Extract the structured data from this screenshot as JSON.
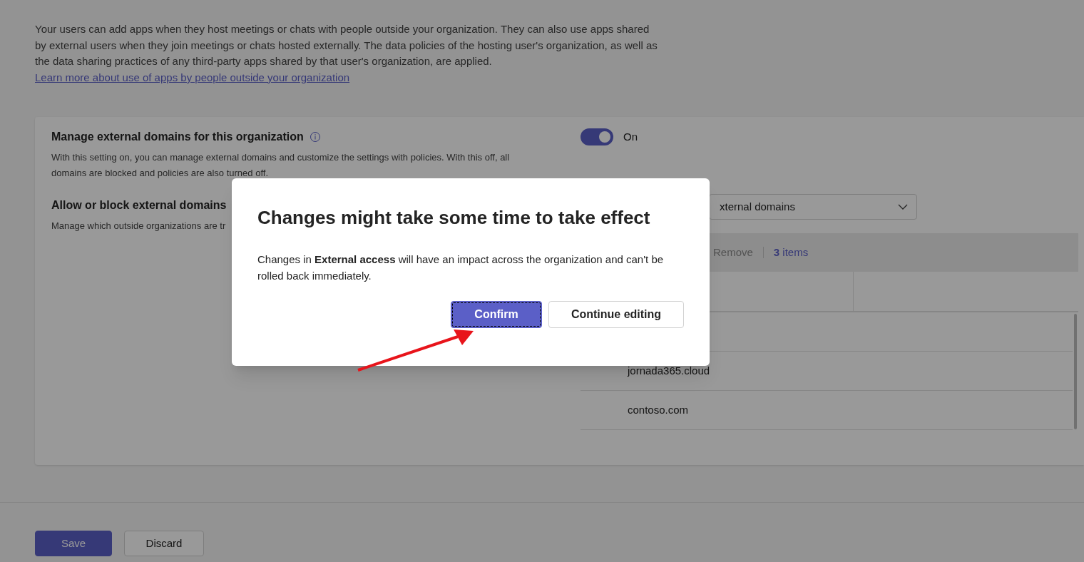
{
  "intro": {
    "text": "Your users can add apps when they host meetings or chats with people outside your organization. They can also use apps shared by external users when they join meetings or chats hosted externally. The data policies of the hosting user's organization, as well as the data sharing practices of any third-party apps shared by that user's organization, are applied.",
    "link": "Learn more about use of apps by people outside your organization"
  },
  "settings": [
    {
      "kind": "toggle",
      "title": "Manage external domains for this organization",
      "info": true,
      "description": "With this setting on, you can manage external domains and customize the settings with policies. With this off, all domains are blocked and policies are also turned off.",
      "toggle": {
        "on": true,
        "label": "On"
      }
    },
    {
      "kind": "domains",
      "title": "Allow or block external domains",
      "info": false,
      "description": "Manage which outside organizations are tr",
      "dropdown": {
        "value": "xternal domains"
      },
      "toolbar": {
        "remove": {
          "label": "Remove",
          "disabled": true
        },
        "count": "**3** items"
      },
      "rows": [
        "jornada365.cloud",
        "contoso.com"
      ]
    }
  ],
  "footer": [
    {
      "label": "Save",
      "kind": "primary"
    },
    {
      "label": "Discard",
      "kind": "secondary"
    }
  ],
  "dialog": {
    "title": "Changes might take some time to take effect",
    "body": "Changes in **External access** will have an impact across the organization and can't be rolled back immediately.",
    "buttons": [
      {
        "label": "Confirm",
        "kind": "primary",
        "focused": true
      },
      {
        "label": "Continue editing",
        "kind": "secondary",
        "focused": false
      }
    ]
  }
}
